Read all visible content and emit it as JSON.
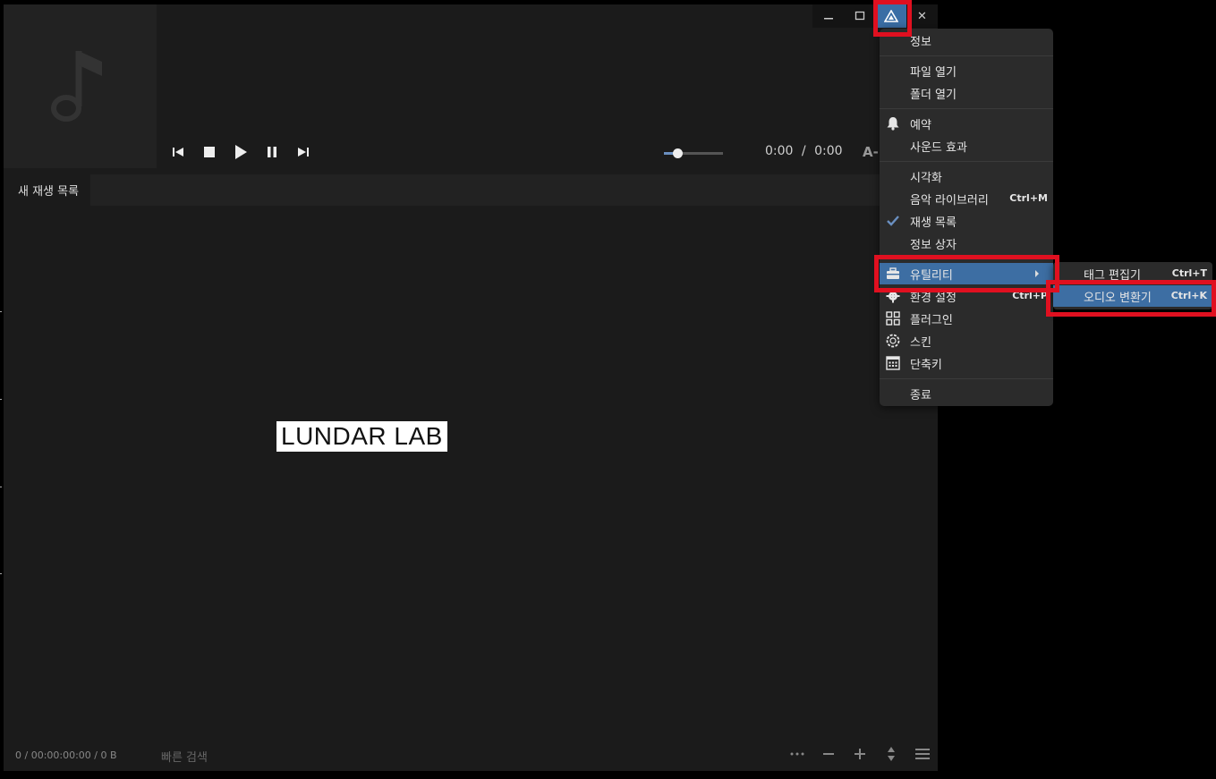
{
  "window": {
    "minimize_icon": "minimize-icon",
    "maximize_icon": "maximize-icon",
    "app_menu_icon": "app-logo-icon",
    "close_label": "✕"
  },
  "player": {
    "album_art_icon": "music-note-icon",
    "time_current": "0:00",
    "time_separator": "/",
    "time_total": "0:00",
    "ab_label": "A-",
    "volume_level": 0.22
  },
  "playlist": {
    "tab_label": "새 재생 목록"
  },
  "watermark": {
    "text": "LUNDAR LAB"
  },
  "statusbar": {
    "status_text": "0 / 00:00:00:00 / 0 B",
    "search_placeholder": "빠른 검색"
  },
  "main_menu": {
    "items": [
      {
        "label": "정보",
        "shortcut": "",
        "icon": ""
      },
      {
        "label": "파일 열기",
        "shortcut": "",
        "icon": ""
      },
      {
        "label": "폴더 열기",
        "shortcut": "",
        "icon": ""
      },
      {
        "label": "예약",
        "shortcut": "",
        "icon": "bell-icon"
      },
      {
        "label": "사운드 효과",
        "shortcut": "",
        "icon": ""
      },
      {
        "label": "시각화",
        "shortcut": "",
        "icon": ""
      },
      {
        "label": "음악 라이브러리",
        "shortcut": "Ctrl+M",
        "icon": ""
      },
      {
        "label": "재생 목록",
        "shortcut": "",
        "icon": "check-icon"
      },
      {
        "label": "정보 상자",
        "shortcut": "",
        "icon": ""
      },
      {
        "label": "유틸리티",
        "shortcut": "",
        "icon": "toolbox-icon"
      },
      {
        "label": "환경 설정",
        "shortcut": "Ctrl+P",
        "icon": "gear-icon"
      },
      {
        "label": "플러그인",
        "shortcut": "",
        "icon": "plugin-grid-icon"
      },
      {
        "label": "스킨",
        "shortcut": "",
        "icon": "skin-icon"
      },
      {
        "label": "단축키",
        "shortcut": "",
        "icon": "keyboard-icon"
      },
      {
        "label": "종료",
        "shortcut": "",
        "icon": ""
      }
    ]
  },
  "utility_submenu": {
    "items": [
      {
        "label": "태그 편집기",
        "shortcut": "Ctrl+T"
      },
      {
        "label": "오디오 변환기",
        "shortcut": "Ctrl+K"
      }
    ]
  },
  "colors": {
    "highlight": "#e01020",
    "selection": "#3d6ea3",
    "background": "#1b1b1b"
  }
}
